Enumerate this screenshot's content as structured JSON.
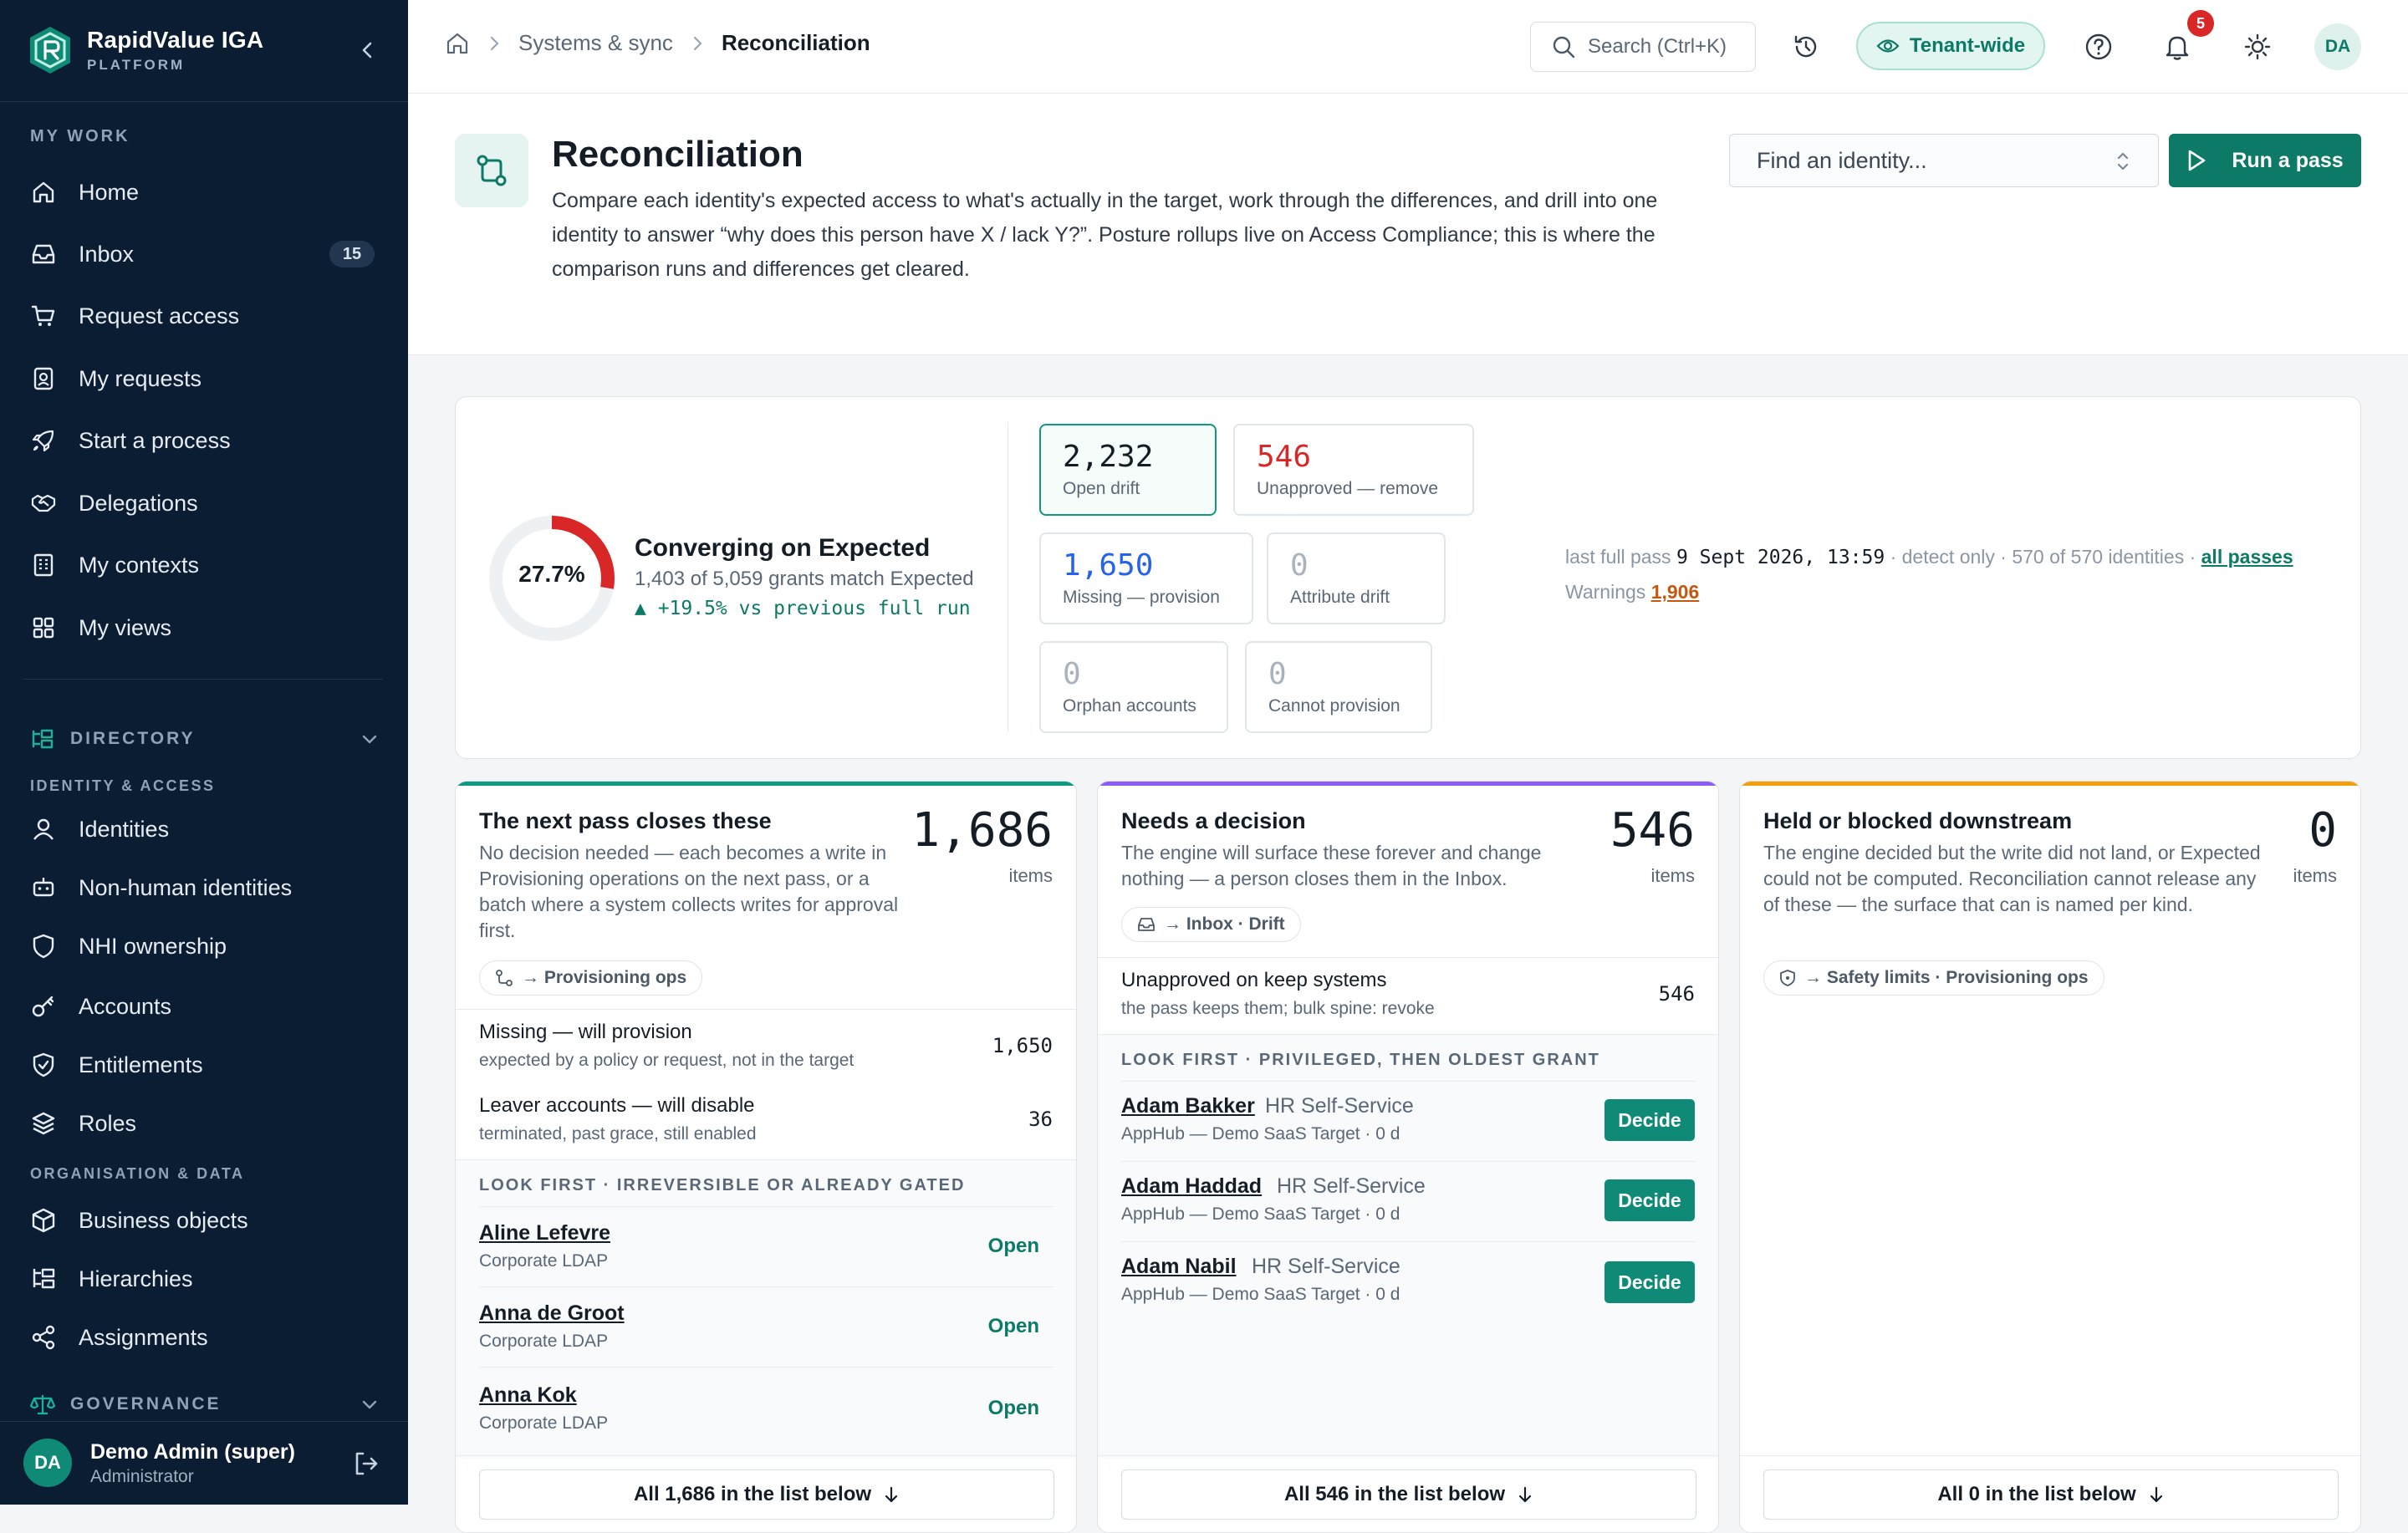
{
  "brand": {
    "name": "RapidValue IGA",
    "sub": "PLATFORM"
  },
  "sidebar": {
    "my_work_label": "MY WORK",
    "my_work": [
      {
        "label": "Home",
        "icon": "home-icon"
      },
      {
        "label": "Inbox",
        "icon": "inbox-icon",
        "badge": "15"
      },
      {
        "label": "Request access",
        "icon": "cart-icon"
      },
      {
        "label": "My requests",
        "icon": "requests-icon"
      },
      {
        "label": "Start a process",
        "icon": "rocket-icon"
      },
      {
        "label": "Delegations",
        "icon": "handshake-icon"
      },
      {
        "label": "My contexts",
        "icon": "building-icon"
      },
      {
        "label": "My views",
        "icon": "grid-icon"
      }
    ],
    "directory_label": "DIRECTORY",
    "identity_access_label": "IDENTITY & ACCESS",
    "identity_access": [
      {
        "label": "Identities",
        "icon": "user-icon"
      },
      {
        "label": "Non-human identities",
        "icon": "bot-icon"
      },
      {
        "label": "NHI ownership",
        "icon": "shield-icon"
      },
      {
        "label": "Accounts",
        "icon": "key-icon"
      },
      {
        "label": "Entitlements",
        "icon": "shield-check-icon"
      },
      {
        "label": "Roles",
        "icon": "layers-icon"
      }
    ],
    "org_data_label": "ORGANISATION & DATA",
    "org_data": [
      {
        "label": "Business objects",
        "icon": "box-icon"
      },
      {
        "label": "Hierarchies",
        "icon": "hierarchy-icon"
      },
      {
        "label": "Assignments",
        "icon": "share-icon"
      }
    ],
    "governance_label": "GOVERNANCE",
    "user": {
      "initials": "DA",
      "name": "Demo Admin (super)",
      "role": "Administrator"
    }
  },
  "topbar": {
    "breadcrumb_parent": "Systems & sync",
    "breadcrumb_current": "Reconciliation",
    "search_placeholder": "Search (Ctrl+K)",
    "scope_label": "Tenant-wide",
    "notifications_count": "5",
    "avatar_initials": "DA"
  },
  "header": {
    "title": "Reconciliation",
    "description": "Compare each identity's expected access to what's actually in the target, work through the differences, and drill into one identity to answer “why does this person have X / lack Y?”. Posture rollups live on Access Compliance; this is where the comparison runs and differences get cleared.",
    "find_placeholder": "Find an identity...",
    "run_label": "Run a pass"
  },
  "summary": {
    "percent_label": "27.7%",
    "percent_value": 27.7,
    "title": "Converging on Expected",
    "subtitle": "1,403 of 5,059 grants match Expected",
    "delta": "▲ +19.5% vs previous full run",
    "tiles": [
      {
        "value": "2,232",
        "caption": "Open drift"
      },
      {
        "value": "546",
        "caption": "Unapproved — remove"
      },
      {
        "value": "1,650",
        "caption": "Missing — provision"
      },
      {
        "value": "0",
        "caption": "Attribute drift"
      },
      {
        "value": "0",
        "caption": "Orphan accounts"
      },
      {
        "value": "0",
        "caption": "Cannot provision"
      }
    ],
    "last_pass_label": "last full pass",
    "last_pass_date": "9 Sept 2026, 13:59",
    "last_pass_detail": "· detect only · 570 of 570 identities ·",
    "all_passes_label": "all passes",
    "warnings_label": "Warnings",
    "warnings_value": "1,906"
  },
  "columns": {
    "next": {
      "title": "The next pass closes these",
      "desc": "No decision needed — each becomes a write in Provisioning operations on the next pass, or a batch where a system collects writes for approval first.",
      "count": "1,686",
      "items_label": "items",
      "chip": "→ Provisioning ops",
      "rows": [
        {
          "title": "Missing — will provision",
          "sub": "expected by a policy or request, not in the target",
          "value": "1,650"
        },
        {
          "title": "Leaver accounts — will disable",
          "sub": "terminated, past grace, still enabled",
          "value": "36"
        }
      ],
      "look_first": "LOOK FIRST · IRREVERSIBLE OR ALREADY GATED",
      "people": [
        {
          "name": "Aline Lefevre",
          "source": "Corporate LDAP",
          "action": "Open"
        },
        {
          "name": "Anna de Groot",
          "source": "Corporate LDAP",
          "action": "Open"
        },
        {
          "name": "Anna Kok",
          "source": "Corporate LDAP",
          "action": "Open"
        }
      ],
      "list_button": "All 1,686 in the list below"
    },
    "decision": {
      "title": "Needs a decision",
      "desc": "The engine will surface these forever and change nothing — a person closes them in the Inbox.",
      "count": "546",
      "items_label": "items",
      "chip": "→ Inbox · Drift",
      "rows": [
        {
          "title": "Unapproved on keep systems",
          "sub": "the pass keeps them; bulk spine: revoke",
          "value": "546"
        }
      ],
      "look_first": "LOOK FIRST · PRIVILEGED, THEN OLDEST GRANT",
      "people": [
        {
          "name": "Adam Bakker",
          "role": "HR Self-Service",
          "source": "AppHub — Demo SaaS Target · 0 d",
          "action": "Decide"
        },
        {
          "name": "Adam Haddad",
          "role": "HR Self-Service",
          "source": "AppHub — Demo SaaS Target · 0 d",
          "action": "Decide"
        },
        {
          "name": "Adam Nabil",
          "role": "HR Self-Service",
          "source": "AppHub — Demo SaaS Target · 0 d",
          "action": "Decide"
        }
      ],
      "list_button": "All 546 in the list below"
    },
    "held": {
      "title": "Held or blocked downstream",
      "desc": "The engine decided but the write did not land, or Expected could not be computed. Reconciliation cannot release any of these — the surface that can is named per kind.",
      "count": "0",
      "items_label": "items",
      "chip": "→ Safety limits · Provisioning ops",
      "list_button": "All 0 in the list below"
    }
  },
  "colors": {
    "accent": "#0c7a66",
    "sidebar_bg": "#0b1d33",
    "danger": "#d92626",
    "info": "#2563eb",
    "next_bar": "#0e9a80",
    "decision_bar": "#8b5cf6",
    "held_bar": "#f59e0b",
    "warning_link": "#c2590f"
  }
}
